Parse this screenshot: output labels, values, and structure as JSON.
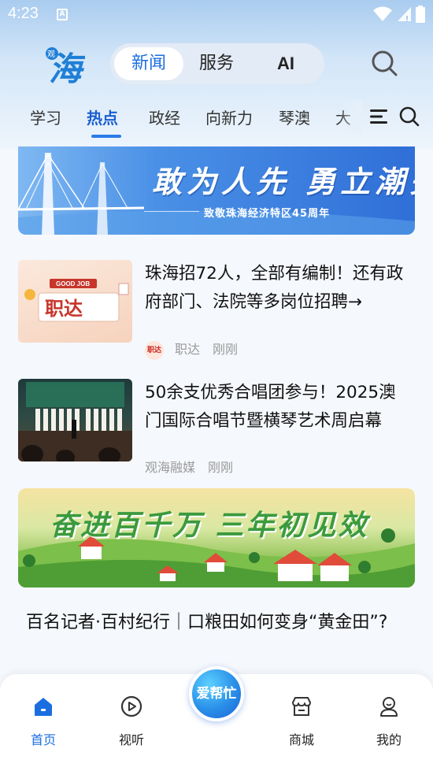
{
  "status_bar": {
    "time": "4:23"
  },
  "header": {
    "logo_text": "海",
    "logo_small": "观",
    "segments": [
      "新闻",
      "服务",
      "AI"
    ],
    "active_segment": "新闻"
  },
  "tabs": [
    "学习",
    "热点",
    "政经",
    "向新力",
    "琴澳",
    "大"
  ],
  "active_tab": "热点",
  "banner_top": {
    "slogan": "敢为人先 勇立潮头",
    "subtitle": "致敬珠海经济特区45周年"
  },
  "news": [
    {
      "title": "珠海招72人，全部有编制！还有政府部门、法院等多岗位招聘→",
      "source": "职达",
      "time": "刚刚",
      "thumb_text": "职达",
      "thumb_badge": "GOOD JOB"
    },
    {
      "title": "50余支优秀合唱团参与！2025澳门国际合唱节暨横琴艺术周启幕",
      "source": "观海融媒",
      "time": "刚刚"
    }
  ],
  "banner_mid": {
    "slogan": "奋进百千万 三年初见效"
  },
  "headline": "百名记者·百村纪行｜口粮田如何变身“黄金田”?",
  "bottom_nav": {
    "items": [
      "首页",
      "视听",
      "商城",
      "我的"
    ],
    "center_button": "爱帮忙",
    "active": "首页"
  },
  "colors": {
    "accent": "#1b6ee0",
    "tab_active": "#1b5fcf"
  }
}
